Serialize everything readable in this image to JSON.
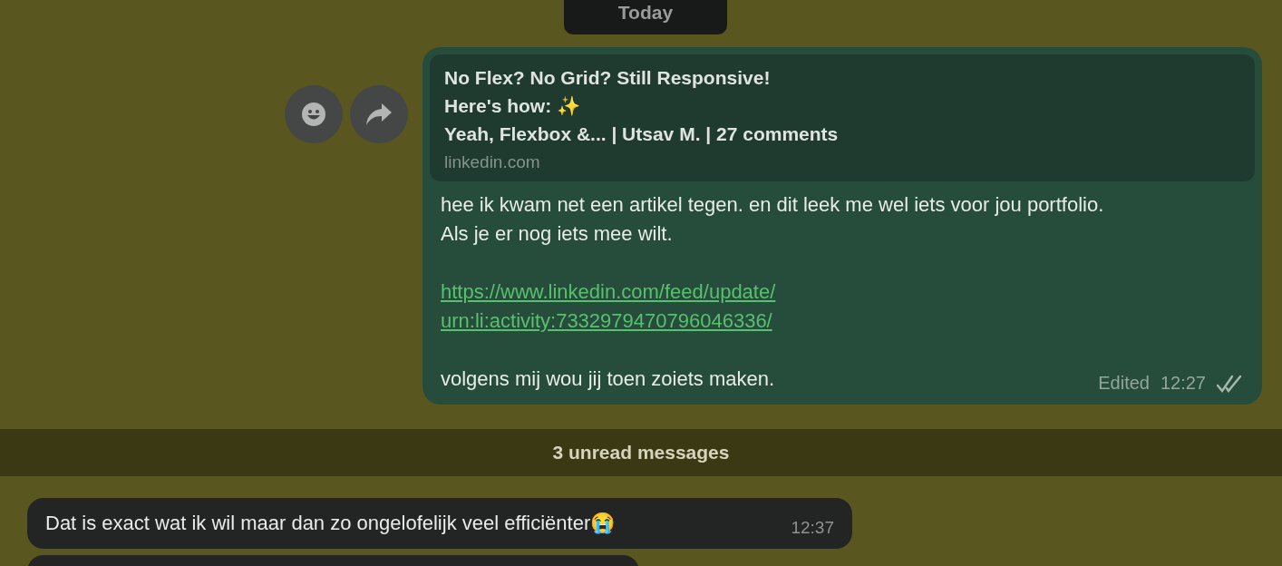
{
  "date_divider": "Today",
  "outgoing_message": {
    "link_preview": {
      "title_lines": [
        "No Flex? No Grid? Still Responsive!",
        "Here's how: ✨",
        "Yeah, Flexbox &... | Utsav M. | 27 comments"
      ],
      "domain": "linkedin.com"
    },
    "text": "hee ik kwam net een artikel tegen. en dit leek me wel iets voor jou portfolio. Als je er nog iets mee wilt.",
    "link_lines": [
      "https://www.linkedin.com/feed/update/",
      "urn:li:activity:7332979470796046336/"
    ],
    "closing": "volgens mij wou jij toen zoiets maken.",
    "edited": "Edited",
    "time": "12:27",
    "read": true
  },
  "unread_divider": "3 unread messages",
  "incoming_messages": [
    {
      "text": "Dat is exact wat ik wil maar dan zo ongelofelijk veel efficiënter😭",
      "time": "12:37"
    }
  ]
}
